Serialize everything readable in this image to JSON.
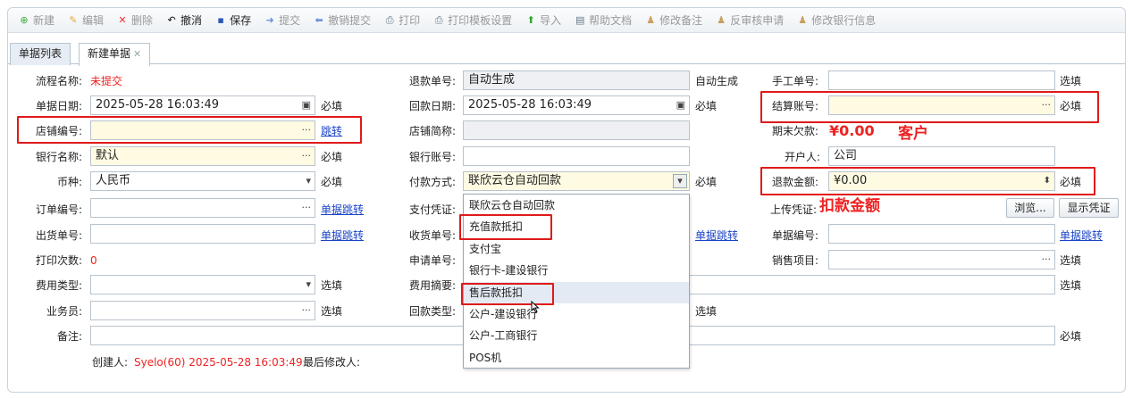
{
  "toolbar": {
    "items": [
      {
        "label": "新建",
        "icon": "plus-circle-icon",
        "enabled": false
      },
      {
        "label": "编辑",
        "icon": "pencil-icon",
        "enabled": false
      },
      {
        "label": "删除",
        "icon": "x-icon",
        "enabled": false
      },
      {
        "label": "撤消",
        "icon": "undo-icon",
        "enabled": true
      },
      {
        "label": "保存",
        "icon": "floppy-disk-icon",
        "enabled": true
      },
      {
        "label": "提交",
        "icon": "arrow-right-icon",
        "enabled": false
      },
      {
        "label": "撤销提交",
        "icon": "arrow-left-icon",
        "enabled": false
      },
      {
        "label": "打印",
        "icon": "printer-icon",
        "enabled": false
      },
      {
        "label": "打印模板设置",
        "icon": "printer-settings-icon",
        "enabled": false
      },
      {
        "label": "导入",
        "icon": "arrow-up-icon",
        "enabled": false
      },
      {
        "label": "帮助文档",
        "icon": "document-icon",
        "enabled": false
      },
      {
        "label": "修改备注",
        "icon": "user-icon",
        "enabled": false
      },
      {
        "label": "反审核申请",
        "icon": "user-icon",
        "enabled": false
      },
      {
        "label": "修改银行信息",
        "icon": "user-icon",
        "enabled": false
      }
    ]
  },
  "tabs": {
    "list": "单据列表",
    "new": "新建单据",
    "close": "✕"
  },
  "form": {
    "flow_name": {
      "label": "流程名称:",
      "value": "未提交"
    },
    "doc_date": {
      "label": "单据日期:",
      "value": "2025-05-28 16:03:49",
      "hint": "必填"
    },
    "store_code": {
      "label": "店铺编号:",
      "value": "",
      "link": "跳转"
    },
    "bank_name": {
      "label": "银行名称:",
      "value": "默认",
      "hint": "必填"
    },
    "currency": {
      "label": "币种:",
      "value": "人民币",
      "hint": "必填"
    },
    "order_no": {
      "label": "订单编号:",
      "value": "",
      "link": "单据跳转"
    },
    "ship_no": {
      "label": "出货单号:",
      "value": "",
      "link": "单据跳转"
    },
    "print_count": {
      "label": "打印次数:",
      "value": "0"
    },
    "fee_type": {
      "label": "费用类型:",
      "value": "",
      "hint": "选填"
    },
    "salesman": {
      "label": "业务员:",
      "value": "",
      "hint": "选填"
    },
    "remark": {
      "label": "备注:",
      "value": "",
      "hint": "必填"
    },
    "refund_no": {
      "label": "退款单号:",
      "value": "自动生成",
      "hint": "自动生成"
    },
    "receive_date": {
      "label": "回款日期:",
      "value": "2025-05-28 16:03:49",
      "hint": "必填"
    },
    "store_short": {
      "label": "店铺简称:",
      "value": ""
    },
    "bank_account": {
      "label": "银行账号:",
      "value": ""
    },
    "pay_method": {
      "label": "付款方式:",
      "value": "联欣云仓自动回款",
      "hint": "必填"
    },
    "pay_voucher": {
      "label": "支付凭证:"
    },
    "receipt_no": {
      "label": "收货单号:",
      "link": "单据跳转"
    },
    "apply_no": {
      "label": "申请单号:"
    },
    "fee_summary": {
      "label": "费用摘要:",
      "hint": "选填"
    },
    "receive_type": {
      "label": "回款类型:",
      "hint": "选填"
    },
    "manual_no": {
      "label": "手工单号:",
      "value": "",
      "hint": "选填"
    },
    "settle_account": {
      "label": "结算账号:",
      "value": "",
      "hint": "必填"
    },
    "ending_debt": {
      "label": "期末欠款:",
      "value": "¥0.00"
    },
    "account_holder": {
      "label": "开户人:",
      "value": "公司"
    },
    "refund_amount": {
      "label": "退款金额:",
      "value": "¥0.00",
      "hint": "必填"
    },
    "upload_voucher": {
      "label": "上传凭证:",
      "browse": "浏览...",
      "show": "显示凭证"
    },
    "doc_no": {
      "label": "单据编号:",
      "value": "",
      "link": "单据跳转"
    },
    "sales_item": {
      "label": "销售项目:",
      "value": "",
      "hint": "选填"
    },
    "creator": {
      "label": "创建人:",
      "value": "Syelo(60) 2025-05-28 16:03:49"
    },
    "last_modifier": {
      "label": "最后修改人:",
      "value": ""
    }
  },
  "dropdown": {
    "options": [
      "联欣云仓自动回款",
      "充值款抵扣",
      "支付宝",
      "银行卡-建设银行",
      "售后款抵扣",
      "公户-建设银行",
      "公户-工商银行",
      "POS机"
    ],
    "highlighted_index": 4
  },
  "annotations": {
    "customer": "客户",
    "deduct_amount": "扣款金额"
  },
  "colors": {
    "annotation": "#e01a1a",
    "link": "#1a44c8",
    "required_bg": "#fffbe3"
  }
}
